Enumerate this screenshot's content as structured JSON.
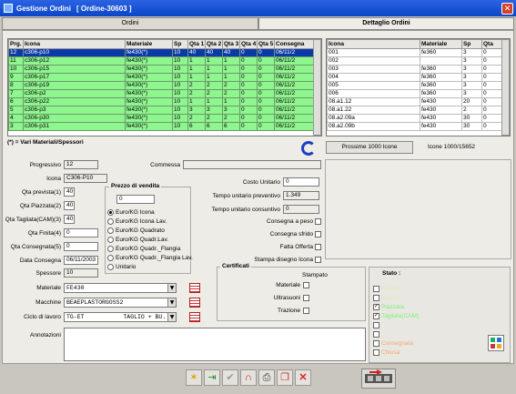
{
  "window": {
    "title": "Gestione Ordini",
    "subtitle": "[ Ordine-30603 ]"
  },
  "tabs": [
    {
      "label": "Ordini"
    },
    {
      "label": "Dettaglio Ordini"
    }
  ],
  "orders_table": {
    "columns": [
      "Prg.",
      "Icona",
      "Materiale",
      "Sp",
      "Qta 1",
      "Qta 2",
      "Qta 3",
      "Qta 4",
      "Qta 5",
      "Consegna"
    ],
    "rows": [
      [
        "12",
        "c306-p10",
        "fe430(*)",
        "10",
        "40",
        "40",
        "40",
        "0",
        "0",
        "06/11/2"
      ],
      [
        "11",
        "c306-p12",
        "fe430(*)",
        "10",
        "1",
        "1",
        "1",
        "0",
        "0",
        "06/11/2"
      ],
      [
        "10",
        "c306-p15",
        "fe430(*)",
        "10",
        "1",
        "1",
        "1",
        "0",
        "0",
        "06/11/2"
      ],
      [
        "9",
        "c306-p17",
        "fe430(*)",
        "10",
        "1",
        "1",
        "1",
        "0",
        "0",
        "06/11/2"
      ],
      [
        "8",
        "c306-p19",
        "fe430(*)",
        "10",
        "2",
        "2",
        "2",
        "0",
        "0",
        "06/11/2"
      ],
      [
        "7",
        "c306-p2",
        "fe430(*)",
        "10",
        "2",
        "2",
        "2",
        "0",
        "0",
        "06/11/2"
      ],
      [
        "6",
        "c306-p22",
        "fe430(*)",
        "10",
        "1",
        "1",
        "1",
        "0",
        "0",
        "06/11/2"
      ],
      [
        "5",
        "c306-p3",
        "fe430(*)",
        "10",
        "3",
        "3",
        "3",
        "0",
        "0",
        "06/11/2"
      ],
      [
        "4",
        "c306-p30",
        "fe430(*)",
        "10",
        "2",
        "2",
        "2",
        "0",
        "0",
        "06/11/2"
      ],
      [
        "3",
        "c306-p31",
        "fe430(*)",
        "10",
        "6",
        "6",
        "6",
        "0",
        "0",
        "06/11/2"
      ]
    ],
    "footnote": "(*) = Vari Materiali/Spessori"
  },
  "detail_table": {
    "columns": [
      "Icona",
      "Materiale",
      "Sp",
      "Qta"
    ],
    "rows": [
      [
        "001",
        "fe360",
        "3",
        "0"
      ],
      [
        "002",
        "",
        "3",
        "0"
      ],
      [
        "003",
        "fe360",
        "3",
        "0"
      ],
      [
        "004",
        "fe360",
        "3",
        "0"
      ],
      [
        "005",
        "fe360",
        "3",
        "0"
      ],
      [
        "006",
        "fe360",
        "3",
        "0"
      ],
      [
        "08.a1.12",
        "fe430",
        "20",
        "0"
      ],
      [
        "08.a1.22",
        "fe430",
        "2",
        "0"
      ],
      [
        "08.a2.09a",
        "fe430",
        "30",
        "0"
      ],
      [
        "08.a2.09b",
        "fe430",
        "30",
        "0"
      ]
    ],
    "next_button": "Prossime 1000 Icone",
    "icon_count": "Icone 1000/15652"
  },
  "form": {
    "progressivo_label": "Progressivo",
    "progressivo": "12",
    "commessa_label": "Commessa",
    "commessa": "",
    "icona_label": "Icona",
    "icona": "C306-P10",
    "qta_prevista_label": "Qta prevista(1)",
    "qta_prevista": "40",
    "qta_piazzata_label": "Qta Piazzata(2)",
    "qta_piazzata": "40",
    "qta_tagliata_label": "Qta Tagliata(CAM)(3)",
    "qta_tagliata": "40",
    "qta_finita_label": "Qta Finita(4)",
    "qta_finita": "0",
    "qta_consegnata_label": "Qta Consegnata(5)",
    "qta_consegnata": "0",
    "data_consegna_label": "Data Consegna",
    "data_consegna": "06/11/2003",
    "spessore_label": "Spessore",
    "spessore": "10",
    "costo_unitario_label": "Costo Unitario",
    "costo_unitario": "0",
    "tempo_prev_label": "Tempo unitario preventivo",
    "tempo_prev": "1.349",
    "tempo_cons_label": "Tempo unitario consuntivo",
    "tempo_cons": "0",
    "consegna_peso_label": "Consegna a peso",
    "consegna_sfrido_label": "Consegna sfrido",
    "fatta_offerta_label": "Fatta Offerta",
    "stampa_disegno_label": "Stampa disegno Icona",
    "materiale_label": "Materiale",
    "materiale": "FE430",
    "macchine_label": "Macchine",
    "macchine": "BEAEPLASTORGOSS2",
    "ciclo_label": "Ciclo di lavoro",
    "ciclo": "TG-ET           TAGLIO + BU.",
    "annotazioni_label": "Annotazioni",
    "annotazioni": ""
  },
  "prezzo": {
    "title": "Prezzo di vendita",
    "value": "0",
    "options": [
      "Euro/KG Icona",
      "Euro/KG Icona Lav.",
      "Euro/KG Quadrato",
      "Euro/KG Quadr.Lav.",
      "Euro/KG Quadr._Flangia",
      "Euro/KG Quadr._Flangia Lav.",
      "Unitario"
    ],
    "selected_index": 0
  },
  "certificati": {
    "title": "Certificati",
    "stampato_label": "Stampato",
    "items": [
      "Materiale",
      "Ultrasuoni",
      "Trazione"
    ]
  },
  "stato": {
    "title": "Stato :",
    "items": [
      {
        "label": "Inserito",
        "checked": false,
        "color": "#e8e6c0"
      },
      {
        "label": "Scelto",
        "checked": false,
        "color": "#e8e6c0"
      },
      {
        "label": "Piazzata",
        "checked": true,
        "color": "#7cf07c"
      },
      {
        "label": "Tagliata(CAM)",
        "checked": true,
        "color": "#7cf07c"
      },
      {
        "label": "",
        "checked": false,
        "color": "#000000"
      },
      {
        "label": "",
        "checked": false,
        "color": "#000000"
      },
      {
        "label": "Consegnata",
        "checked": false,
        "color": "#f0a878"
      },
      {
        "label": "Chiusa",
        "checked": false,
        "color": "#f0a878"
      }
    ]
  },
  "toolbar": {
    "icons": [
      "new-order-icon",
      "import-icon",
      "confirm-icon",
      "magnet-icon",
      "print-icon",
      "copy-icon",
      "delete-icon"
    ],
    "right_icon": "machine-icon"
  }
}
